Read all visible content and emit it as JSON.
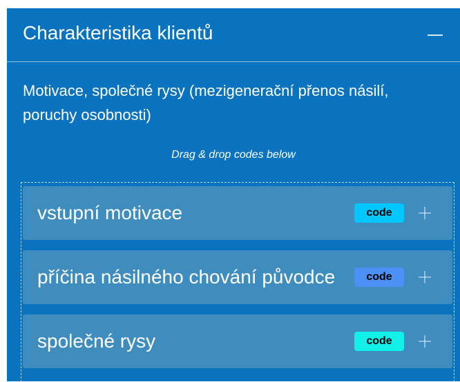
{
  "panel": {
    "title": "Charakteristika klientů",
    "description": "Motivace, společné rysy (mezigenerační přenos násilí, poruchy osobnosti)",
    "hint": "Drag & drop codes below",
    "collapse_icon": "minus-icon"
  },
  "codes": [
    {
      "label": "vstupní motivace",
      "badge": "code",
      "badge_color": "#00c8ff",
      "add_icon": "plus-icon"
    },
    {
      "label": "příčina násilného chování původce",
      "badge": "code",
      "badge_color": "#4a90f5",
      "add_icon": "plus-icon"
    },
    {
      "label": "společné rysy",
      "badge": "code",
      "badge_color": "#12f0ea",
      "add_icon": "plus-icon"
    }
  ],
  "colors": {
    "panel_bg": "#0a73c0",
    "row_bg": "#3f8dbf"
  }
}
